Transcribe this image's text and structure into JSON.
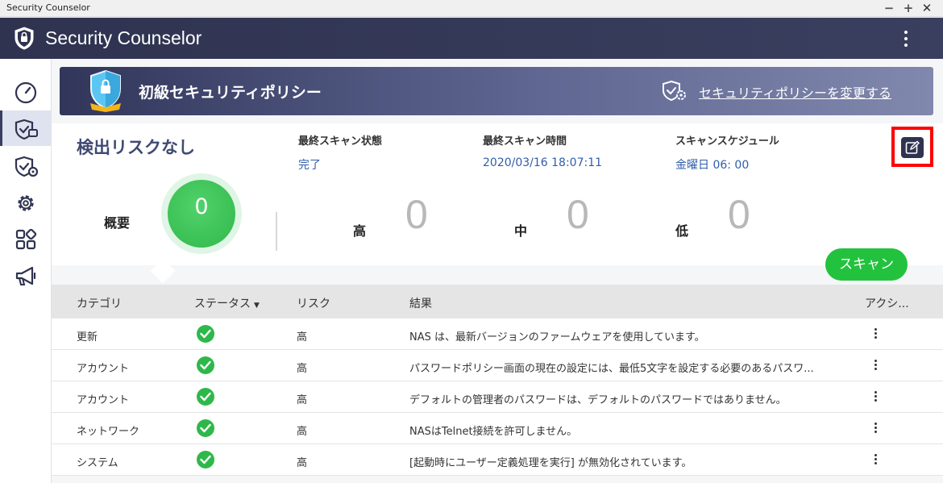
{
  "window": {
    "title": "Security Counselor",
    "controls": {
      "minimize": "−",
      "maximize": "+",
      "close": "✕"
    }
  },
  "header": {
    "title": "Security Counselor"
  },
  "sidebar": {
    "items": [
      {
        "icon": "gauge-icon"
      },
      {
        "icon": "shield-check-icon",
        "active": true
      },
      {
        "icon": "shield-gear-icon"
      },
      {
        "icon": "gear-icon"
      },
      {
        "icon": "apps-grid-icon"
      },
      {
        "icon": "megaphone-icon"
      }
    ]
  },
  "banner": {
    "title": "初級セキュリティポリシー",
    "change_link": "セキュリティポリシーを変更する"
  },
  "summary": {
    "status_title": "検出リスクなし",
    "last_scan_status_label": "最終スキャン状態",
    "last_scan_status_value": "完了",
    "last_scan_time_label": "最終スキャン時間",
    "last_scan_time_value": "2020/03/16 18:07:11",
    "schedule_label": "スキャンスケジュール",
    "schedule_value": "金曜日 06: 00",
    "overview_label": "概要",
    "overview_count": "0",
    "high_label": "高",
    "high_count": "0",
    "medium_label": "中",
    "medium_count": "0",
    "low_label": "低",
    "low_count": "0",
    "scan_button": "スキャン"
  },
  "table": {
    "columns": {
      "category": "カテゴリ",
      "status": "ステータス",
      "risk": "リスク",
      "result": "結果",
      "action": "アクシ..."
    },
    "rows": [
      {
        "category": "更新",
        "risk": "高",
        "result": "NAS は、最新バージョンのファームウェアを使用しています。"
      },
      {
        "category": "アカウント",
        "risk": "高",
        "result": "パスワードポリシー画面の現在の設定には、最低5文字を設定する必要のあるパスワ..."
      },
      {
        "category": "アカウント",
        "risk": "高",
        "result": "デフォルトの管理者のパスワードは、デフォルトのパスワードではありません。"
      },
      {
        "category": "ネットワーク",
        "risk": "高",
        "result": "NASはTelnet接続を許可しません。"
      },
      {
        "category": "システム",
        "risk": "高",
        "result": "[起動時にユーザー定義処理を実行] が無効化されています。"
      }
    ]
  },
  "colors": {
    "header_bg": "#2f3350",
    "accent_green": "#23c23e",
    "highlight_red": "#ff0000",
    "link_blue": "#2f5ea8"
  }
}
